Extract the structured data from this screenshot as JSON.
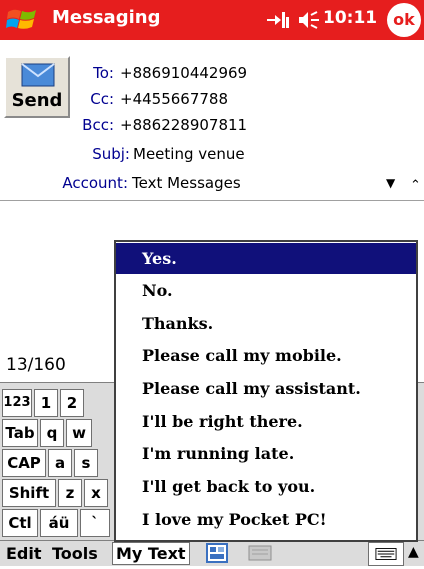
{
  "titlebar": {
    "app_title": "Messaging",
    "time": "10:11",
    "ok_label": "ok",
    "color": "#e61e1e"
  },
  "header": {
    "send_label": "Send",
    "to_label": "To:",
    "to_value": "+886910442969",
    "cc_label": "Cc:",
    "cc_value": "+4455667788",
    "bcc_label": "Bcc:",
    "bcc_value": "+886228907811",
    "subj_label": "Subj:",
    "subj_value": "Meeting venue",
    "account_label": "Account:",
    "account_value": "Text Messages"
  },
  "body": {
    "char_count": "13/160"
  },
  "keyboard": {
    "row1": [
      "123",
      "1",
      "2"
    ],
    "row2": [
      "Tab",
      "q",
      "w"
    ],
    "row3": [
      "CAP",
      "a",
      "s"
    ],
    "row4": [
      "Shift",
      "z",
      "x"
    ],
    "row5": [
      "Ctl",
      "áü",
      "`"
    ]
  },
  "menubar": {
    "edit": "Edit",
    "tools": "Tools",
    "mytext": "My Text"
  },
  "mytext_popup": {
    "items": [
      "Yes.",
      "No.",
      "Thanks.",
      "Please call my mobile.",
      "Please call my assistant.",
      "I'll be right there.",
      "I'm running late.",
      "I'll get back to you.",
      "I love my Pocket PC!"
    ],
    "selected_index": 0,
    "selection_color": "#10107a"
  },
  "icons": [
    "windows-start-icon",
    "network-icon",
    "volume-icon",
    "send-envelope-icon",
    "dropdown-arrow-icon",
    "collapse-icon",
    "keyboard-icon",
    "handwriting-icon",
    "input-selector-arrow-icon"
  ]
}
